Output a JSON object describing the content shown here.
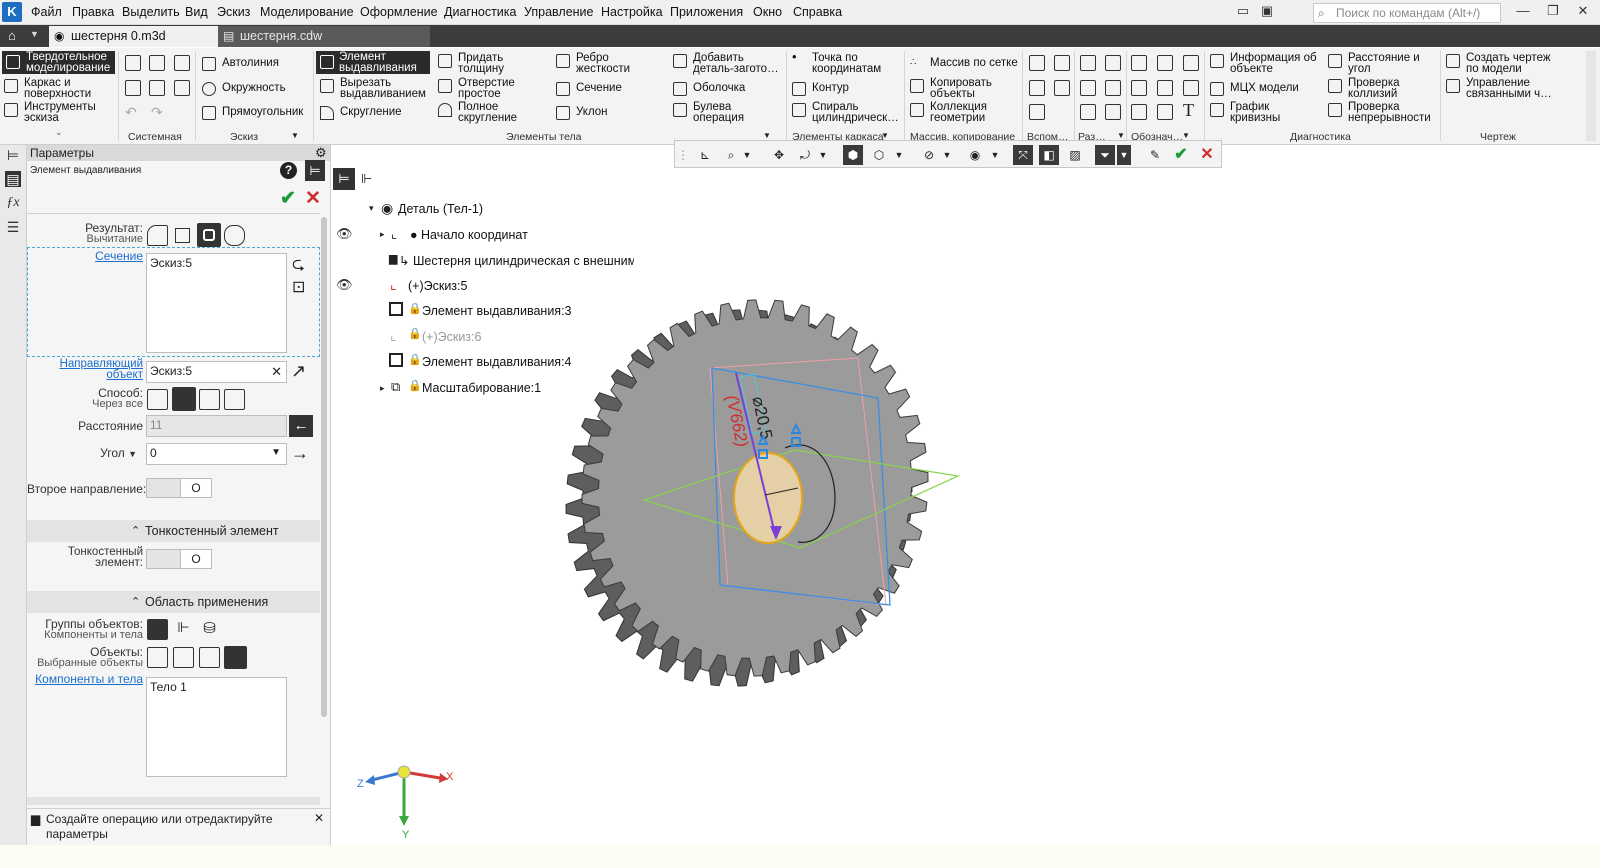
{
  "menu": {
    "items": [
      "Файл",
      "Правка",
      "Выделить",
      "Вид",
      "Эскиз",
      "Моделирование",
      "Оформление",
      "Диагностика",
      "Управление",
      "Настройка",
      "Приложения",
      "Окно",
      "Справка"
    ],
    "search_placeholder": "Поиск по командам (Alt+/)"
  },
  "tabs": [
    {
      "label": "шестерня 0.m3d",
      "active": true
    },
    {
      "label": "шестерня.cdw",
      "active": false
    }
  ],
  "ribbon": {
    "mode": {
      "solid": "Твердотельное моделирование",
      "surfaces": "Каркас и поверхности",
      "sketch_tools": "Инструменты эскиза"
    },
    "sketch": {
      "autoline": "Автолиния",
      "circle": "Окружность",
      "rect": "Прямоугольник"
    },
    "body": {
      "extrude": "Элемент выдавливания",
      "cut_extrude": "Вырезать выдавливанием",
      "fillet": "Скругление",
      "thicken": "Придать толщину",
      "hole": "Отверстие простое",
      "full_round": "Полное скругление",
      "rib": "Ребро жесткости",
      "section": "Сечение",
      "draft": "Уклон",
      "add_stock": "Добавить деталь-загото…",
      "shell": "Оболочка",
      "boolean": "Булева операция"
    },
    "wireframe": {
      "point": "Точка по координатам",
      "contour": "Контур",
      "helix": "Спираль цилиндрическ…"
    },
    "arrays": {
      "grid_array": "Массив по сетке",
      "copy": "Копировать объекты",
      "collection": "Коллекция геометрии"
    },
    "diagnostics": {
      "info": "Информация об объекте",
      "mass": "МЦХ модели",
      "curvature": "График кривизны",
      "distance": "Расстояние и угол",
      "collisions": "Проверка коллизий",
      "continuity": "Проверка непрерывности"
    },
    "drawing": {
      "create": "Создать чертеж по модели",
      "manage": "Управление связанными ч…"
    },
    "groups": {
      "system": "Системная",
      "sketch": "Эскиз",
      "body": "Элементы тела",
      "wire": "Элементы каркаса",
      "arrays": "Массив, копирование",
      "aux": "Вспом…",
      "cuts": "Раз…",
      "notation": "Обознач…",
      "diag": "Диагностика",
      "drawing": "Чертеж"
    }
  },
  "params": {
    "panel_title": "Параметры",
    "op_title": "Элемент выдавливания",
    "result_label": "Результат:",
    "result_value": "Вычитание",
    "section_label": "Сечение",
    "section_value": "Эскиз:5",
    "guide_label": "Направляющий объект",
    "guide_value": "Эскиз:5",
    "method_label": "Способ:",
    "method_value": "Через все",
    "distance_label": "Расстояние",
    "distance_value": "11",
    "angle_label": "Угол",
    "angle_value": "0",
    "second_dir_label": "Второе направление:",
    "thin_section": "Тонкостенный элемент",
    "thin_label": "Тонкостенный элемент:",
    "scope_section": "Область применения",
    "groups_label": "Группы объектов:",
    "groups_value": "Компоненты и тела",
    "objects_label": "Объекты:",
    "objects_value": "Выбранные объекты",
    "components_link": "Компоненты и тела",
    "components_value": "Тело 1"
  },
  "status_message": "Создайте операцию или отредактируйте параметры",
  "tree": {
    "root": "Деталь (Тел-1)",
    "items": [
      {
        "label": "Начало координат",
        "dim": false
      },
      {
        "label": "Шестерня цилиндрическая с внешними зу",
        "dim": false
      },
      {
        "label": "(+)Эскиз:5",
        "dim": false
      },
      {
        "label": "Элемент выдавливания:3",
        "dim": false
      },
      {
        "label": "(+)Эскиз:6",
        "dim": true
      },
      {
        "label": "Элемент выдавливания:4",
        "dim": false
      },
      {
        "label": "Масштабирование:1",
        "dim": false
      }
    ]
  },
  "model": {
    "dim_text": "⌀20,5",
    "dim_red_text": "(Ѵ662)",
    "gear_teeth": 40,
    "gear_color": "#9b9b9b",
    "axis_labels": {
      "x": "X",
      "y": "Y",
      "z": "Z"
    }
  },
  "colors": {
    "accent": "#1e6fc1",
    "ok": "#1a9a3a",
    "cancel": "#d22b2b",
    "selected": "#2b2b2b"
  }
}
